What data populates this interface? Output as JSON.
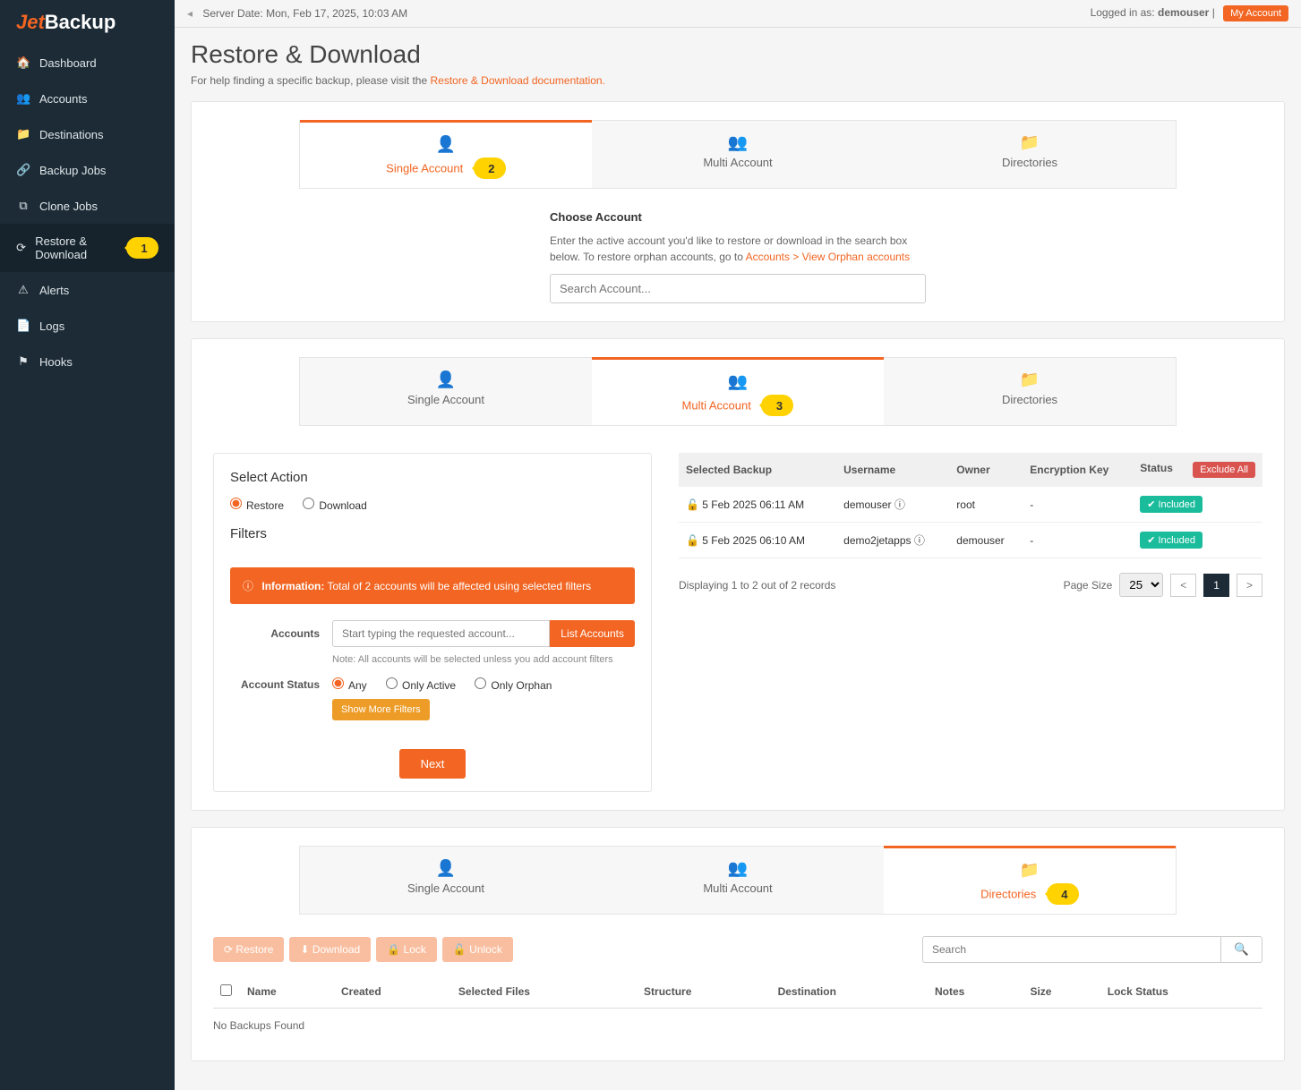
{
  "logo": {
    "part1": "Jet",
    "part2": "Backup"
  },
  "sidebar": {
    "items": [
      {
        "label": "Dashboard"
      },
      {
        "label": "Accounts"
      },
      {
        "label": "Destinations"
      },
      {
        "label": "Backup Jobs"
      },
      {
        "label": "Clone Jobs"
      },
      {
        "label": "Restore & Download"
      },
      {
        "label": "Alerts"
      },
      {
        "label": "Logs"
      },
      {
        "label": "Hooks"
      }
    ]
  },
  "topbar": {
    "server_date_label": "Server Date:",
    "server_date": "Mon, Feb 17, 2025, 10:03 AM",
    "logged_in_label": "Logged in as:",
    "user": "demouser",
    "sep": " | ",
    "my_account_btn": "My Account"
  },
  "page": {
    "title": "Restore & Download",
    "help_pre": "For help finding a specific backup, please visit the ",
    "help_link": "Restore & Download documentation."
  },
  "tabs": {
    "single": "Single Account",
    "multi": "Multi Account",
    "dirs": "Directories"
  },
  "callouts": {
    "c1": "1",
    "c2": "2",
    "c3": "3",
    "c4": "4"
  },
  "section1": {
    "heading": "Choose Account",
    "desc_pre": "Enter the active account you'd like to restore or download in the search box below. To restore orphan accounts, go to ",
    "desc_link": "Accounts > View Orphan accounts",
    "search_placeholder": "Search Account..."
  },
  "section2": {
    "select_action": "Select Action",
    "opt_restore": "Restore",
    "opt_download": "Download",
    "filters": "Filters",
    "info_label": "Information:",
    "info_text": " Total of 2 accounts will be affected using selected filters",
    "accounts_lbl": "Accounts",
    "accounts_ph": "Start typing the requested account...",
    "list_btn": "List Accounts",
    "accounts_note": "Note: All accounts will be selected unless you add account filters",
    "status_lbl": "Account Status",
    "status_any": "Any",
    "status_active": "Only Active",
    "status_orphan": "Only Orphan",
    "show_more": "Show More Filters",
    "next": "Next",
    "table": {
      "headers": {
        "backup": "Selected Backup",
        "username": "Username",
        "owner": "Owner",
        "key": "Encryption Key",
        "status": "Status"
      },
      "exclude_all": "Exclude All",
      "rows": [
        {
          "backup": "5 Feb 2025 06:11 AM",
          "username": "demouser",
          "owner": "root",
          "key": "-",
          "status": "Included"
        },
        {
          "backup": "5 Feb 2025 06:10 AM",
          "username": "demo2jetapps",
          "owner": "demouser",
          "key": "-",
          "status": "Included"
        }
      ]
    },
    "displaying": "Displaying 1 to 2 out of 2 records",
    "page_size_lbl": "Page Size",
    "page_size_val": "25",
    "page_current": "1"
  },
  "section3": {
    "btns": {
      "restore": "Restore",
      "download": "Download",
      "lock": "Lock",
      "unlock": "Unlock"
    },
    "search_ph": "Search",
    "headers": {
      "name": "Name",
      "created": "Created",
      "selfiles": "Selected Files",
      "structure": "Structure",
      "dest": "Destination",
      "notes": "Notes",
      "size": "Size",
      "lockstatus": "Lock Status"
    },
    "empty": "No Backups Found"
  }
}
